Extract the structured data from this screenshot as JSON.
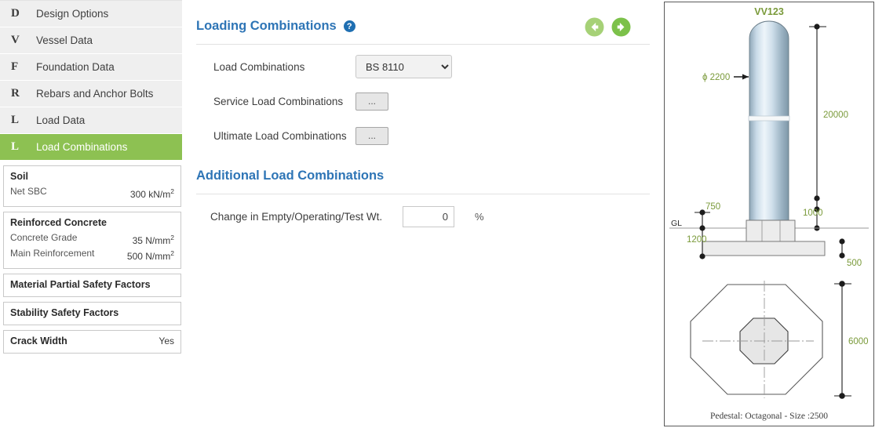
{
  "sidebar": {
    "items": [
      {
        "badge": "D",
        "label": "Design Options",
        "active": false
      },
      {
        "badge": "V",
        "label": "Vessel Data",
        "active": false
      },
      {
        "badge": "F",
        "label": "Foundation Data",
        "active": false
      },
      {
        "badge": "R",
        "label": "Rebars and Anchor Bolts",
        "active": false
      },
      {
        "badge": "L",
        "label": "Load Data",
        "active": false
      },
      {
        "badge": "L",
        "label": "Load Combinations",
        "active": true
      }
    ],
    "cards": [
      {
        "title": "Soil",
        "rows": [
          {
            "label": "Net SBC",
            "value": "300 kN/m",
            "sup": "2"
          }
        ]
      },
      {
        "title": "Reinforced Concrete",
        "rows": [
          {
            "label": "Concrete Grade",
            "value": "35 N/mm",
            "sup": "2"
          },
          {
            "label": "Main Reinforcement",
            "value": "500 N/mm",
            "sup": "2"
          }
        ]
      },
      {
        "title": "Material Partial Safety Factors",
        "rows": []
      },
      {
        "title": "Stability Safety Factors",
        "rows": []
      },
      {
        "title": "Crack Width",
        "rows": [],
        "headline_value": "Yes"
      }
    ]
  },
  "main": {
    "section_title": "Loading Combinations",
    "help_icon": "help-icon",
    "back_icon": "arrow-left-circle-icon",
    "forward_icon": "arrow-right-circle-icon",
    "fields": {
      "load_combinations_label": "Load Combinations",
      "load_combinations_value": "BS 8110",
      "load_combinations_options": [
        "BS 8110"
      ],
      "service_label": "Service Load Combinations",
      "service_button": "...",
      "ultimate_label": "Ultimate Load Combinations",
      "ultimate_button": "..."
    },
    "additional": {
      "title": "Additional Load Combinations",
      "change_label": "Change in Empty/Operating/Test Wt.",
      "change_value": "0",
      "change_unit": "%"
    }
  },
  "drawing": {
    "vessel_tag": "VV123",
    "diameter_label": "ϕ 2200",
    "height_label": "20000",
    "pedestal_height_label": "1000",
    "projection_label": "750",
    "depth_label": "1200",
    "footing_thickness_label": "500",
    "ground_level_label": "GL",
    "plan_width_label": "6000",
    "caption": "Pedestal: Octagonal - Size :2500",
    "colors": {
      "dim_text": "#7a9a3a",
      "outline": "#5a5a5a",
      "vessel_mid": "#dce9f2"
    }
  }
}
